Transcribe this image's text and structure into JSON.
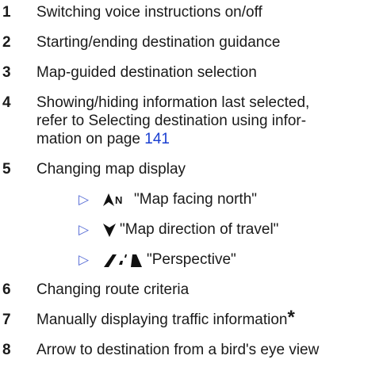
{
  "items": [
    {
      "number": "1",
      "text": "Switching voice instructions on/off"
    },
    {
      "number": "2",
      "text": "Starting/ending destination guidance"
    },
    {
      "number": "3",
      "text": "Map-guided destination selection"
    },
    {
      "number": "4",
      "line1": "Showing/hiding information last selected,",
      "line2": "refer to Selecting destination using infor-",
      "line3_prefix": "mation on page ",
      "page_link": "141"
    },
    {
      "number": "5",
      "text": "Changing map display"
    },
    {
      "number": "6",
      "text": "Changing route criteria"
    },
    {
      "number": "7",
      "text": "Manually displaying traffic information",
      "marker": "*"
    },
    {
      "number": "8",
      "text": "Arrow to destination from a bird's eye view"
    }
  ],
  "map_options": [
    {
      "bullet": "▷",
      "icon": "north-arrow-icon",
      "label": "\"Map facing north\""
    },
    {
      "bullet": "▷",
      "icon": "direction-arrow-icon",
      "label": "\"Map direction of travel\""
    },
    {
      "bullet": "▷",
      "icon": "perspective-road-icon",
      "label": "\"Perspective\""
    }
  ],
  "colors": {
    "text": "#1a1a1a",
    "link": "#1a3fd1",
    "bullet": "#5a6fd6"
  }
}
